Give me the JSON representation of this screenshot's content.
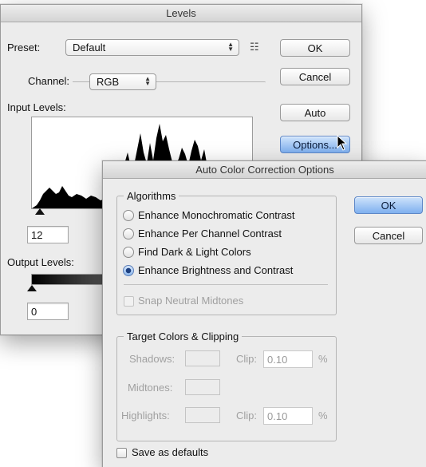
{
  "levels": {
    "title": "Levels",
    "preset_label": "Preset:",
    "preset_value": "Default",
    "ok": "OK",
    "cancel": "Cancel",
    "auto": "Auto",
    "options": "Options...",
    "channel_label": "Channel:",
    "channel_value": "RGB",
    "input_levels_label": "Input Levels:",
    "input_black_value": "12",
    "output_levels_label": "Output Levels:",
    "output_black_value": "0"
  },
  "acc": {
    "title": "Auto Color Correction Options",
    "algorithms_label": "Algorithms",
    "algorithms": [
      {
        "label": "Enhance Monochromatic Contrast",
        "selected": false
      },
      {
        "label": "Enhance Per Channel Contrast",
        "selected": false
      },
      {
        "label": "Find Dark & Light Colors",
        "selected": false
      },
      {
        "label": "Enhance Brightness and Contrast",
        "selected": true
      }
    ],
    "snap_label": "Snap Neutral Midtones",
    "target_label": "Target Colors & Clipping",
    "shadows_label": "Shadows:",
    "midtones_label": "Midtones:",
    "highlights_label": "Highlights:",
    "clip_label": "Clip:",
    "shadows_clip": "0.10",
    "highlights_clip": "0.10",
    "percent": "%",
    "save_defaults": "Save as defaults",
    "ok": "OK",
    "cancel": "Cancel"
  }
}
